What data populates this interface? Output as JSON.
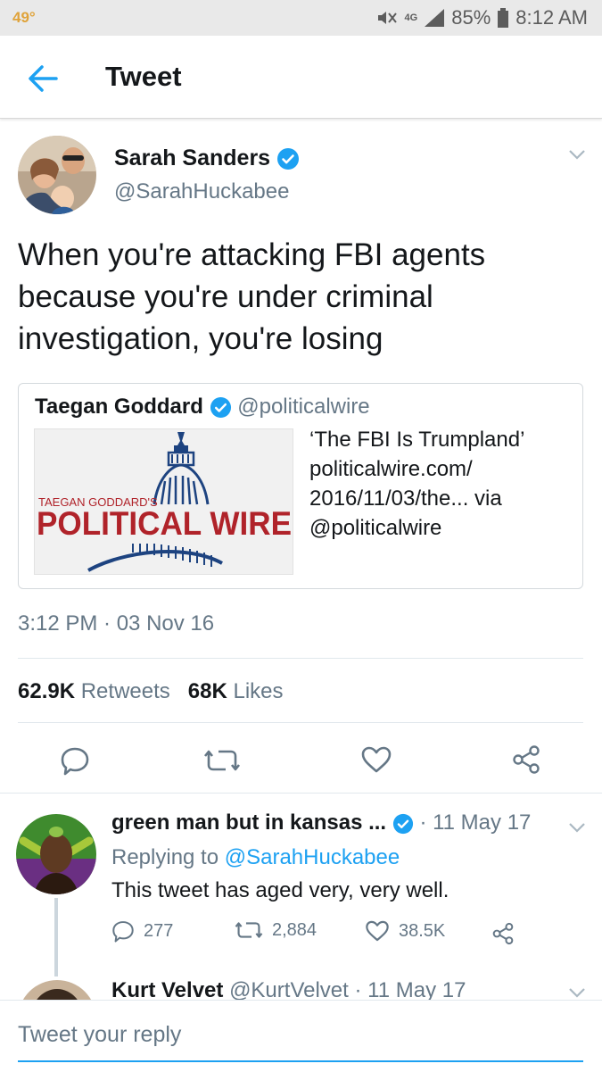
{
  "status_bar": {
    "temperature": "49°",
    "battery": "85%",
    "time": "8:12 AM",
    "network": "4G"
  },
  "header": {
    "title": "Tweet"
  },
  "tweet": {
    "author_name": "Sarah Sanders",
    "author_handle": "@SarahHuckabee",
    "text": "When you're attacking FBI agents because you're under criminal investigation, you're losing",
    "quote": {
      "author_name": "Taegan Goddard",
      "author_handle": "@politicalwire",
      "card_text": "‘The FBI Is Trumpland’ politicalwire.com/ 2016/11/03/the... via @politicalwire",
      "logo_small": "TAEGAN GODDARD'S",
      "logo_big": "POLITICAL WIRE"
    },
    "timestamp": "3:12 PM · 03 Nov 16",
    "retweets_count": "62.9K",
    "retweets_label": "Retweets",
    "likes_count": "68K",
    "likes_label": "Likes"
  },
  "reply": {
    "author_name": "green man but in kansas ...",
    "date": "· 11 May 17",
    "replying_to_label": "Replying to",
    "replying_to_handle": "@SarahHuckabee",
    "text": "This tweet has aged very, very well.",
    "reply_count": "277",
    "retweet_count": "2,884",
    "like_count": "38.5K"
  },
  "next_reply": {
    "author_name": "Kurt Velvet",
    "author_handle": "@KurtVelvet",
    "date": "· 11 May 17"
  },
  "composer": {
    "placeholder": "Tweet your reply"
  },
  "colors": {
    "accent": "#1da1f2",
    "secondary_text": "#657786",
    "wire_red": "#b0232a",
    "wire_blue": "#1d4380"
  }
}
